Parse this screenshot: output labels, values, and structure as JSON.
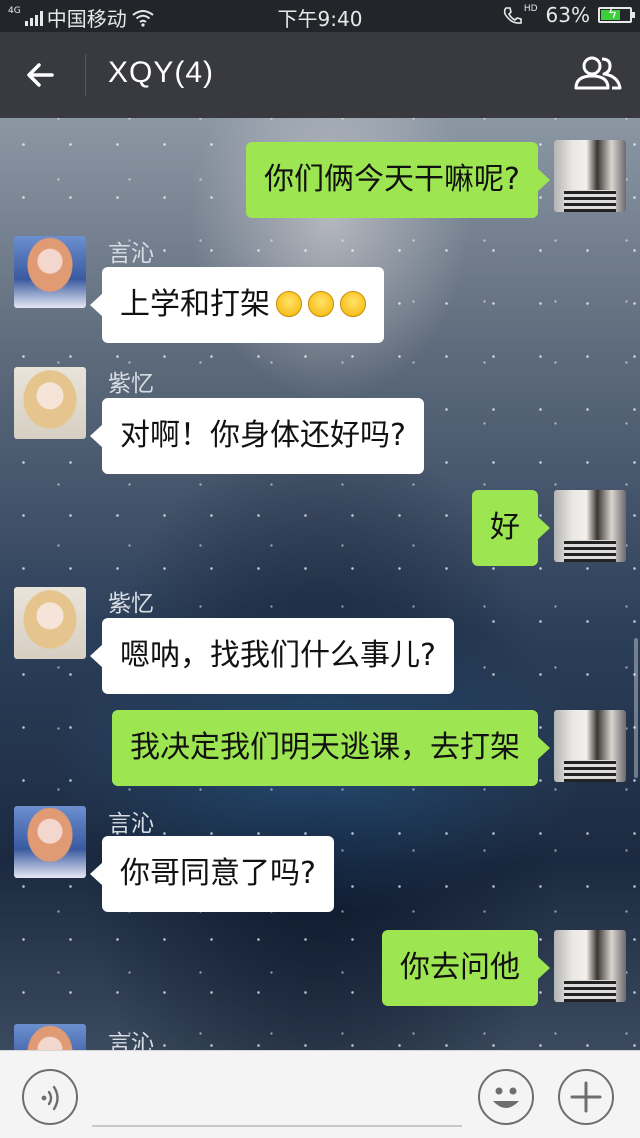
{
  "status_bar": {
    "network_type": "4G",
    "carrier": "中国移动",
    "time": "下午9:40",
    "hd": "HD",
    "battery_percent": "63%",
    "battery_level": 0.63,
    "icons": [
      "signal-icon",
      "wifi-icon",
      "call-hd-icon",
      "battery-charging-icon"
    ]
  },
  "header": {
    "title": "XQY(4)",
    "back_icon": "arrow-left-icon",
    "group_icon": "group-members-icon"
  },
  "messages": [
    {
      "side": "me",
      "text": "你们俩今天干嘛呢?"
    },
    {
      "side": "other",
      "sender": "言沁",
      "text": "上学和打架",
      "emoji_count": 3
    },
    {
      "side": "other",
      "sender": "紫忆",
      "text": "对啊！你身体还好吗?"
    },
    {
      "side": "me",
      "text": "好"
    },
    {
      "side": "other",
      "sender": "紫忆",
      "text": "嗯呐，找我们什么事儿?"
    },
    {
      "side": "me",
      "text": "我决定我们明天逃课，去打架"
    },
    {
      "side": "other",
      "sender": "言沁",
      "text": "你哥同意了吗?"
    },
    {
      "side": "me",
      "text": "你去问他"
    },
    {
      "side": "other",
      "sender": "言沁",
      "text": ""
    }
  ],
  "input_bar": {
    "voice_icon": "voice-icon",
    "emoji_icon": "emoji-icon",
    "plus_icon": "plus-icon",
    "value": ""
  },
  "colors": {
    "my_bubble": "#9de651",
    "other_bubble": "#ffffff",
    "header_bg": "#393a3f",
    "statusbar_bg": "#22262b"
  }
}
